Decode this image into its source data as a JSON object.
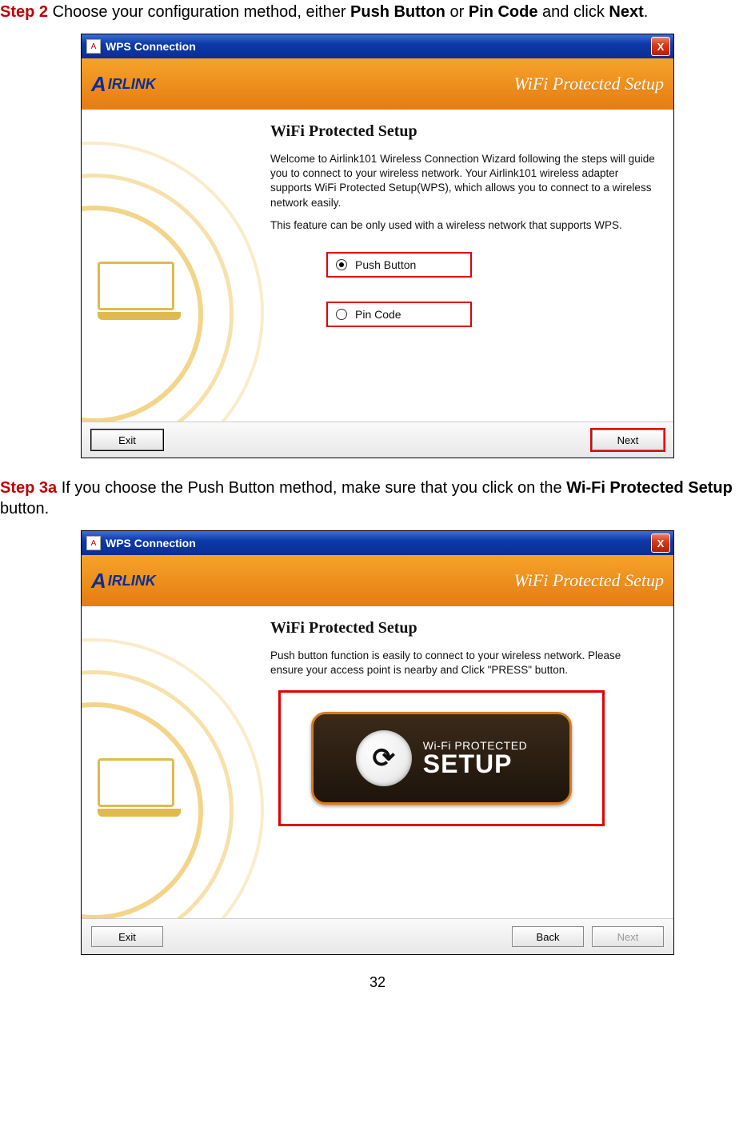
{
  "step2": {
    "label": "Step 2",
    "text_before": " Choose your configuration method, either ",
    "bold1": "Push Button",
    "text_mid": " or ",
    "bold2": "Pin Code",
    "text_after": " and click ",
    "bold3": "Next",
    "period": "."
  },
  "step3a": {
    "label": "Step 3a",
    "text_before": " If you choose the Push Button method, make sure that you click on the ",
    "bold1": "Wi-Fi Protected Setup",
    "text_after": " button."
  },
  "window": {
    "title": "WPS Connection",
    "banner": "WiFi Protected Setup",
    "section_title": "WiFi Protected Setup",
    "logo_a": "A",
    "logo_rest": "IRLINK",
    "close": "X"
  },
  "screen1": {
    "para1": "Welcome to Airlink101 Wireless Connection Wizard following the steps will guide you to connect to your wireless network. Your Airlink101 wireless adapter supports WiFi Protected Setup(WPS), which allows you to connect to a wireless network easily.",
    "para2": "This feature can be only used with a wireless network that supports WPS.",
    "radio_push": "Push Button",
    "radio_pin": "Pin Code",
    "btn_exit": "Exit",
    "btn_next": "Next"
  },
  "screen2": {
    "para1": "Push button function is easily to connect to your wireless network. Please ensure your access point is nearby and Click \"PRESS\" button.",
    "wps_line1": "Wi-Fi PROTECTED",
    "wps_line2": "SETUP",
    "btn_exit": "Exit",
    "btn_back": "Back",
    "btn_next": "Next"
  },
  "page_number": "32"
}
